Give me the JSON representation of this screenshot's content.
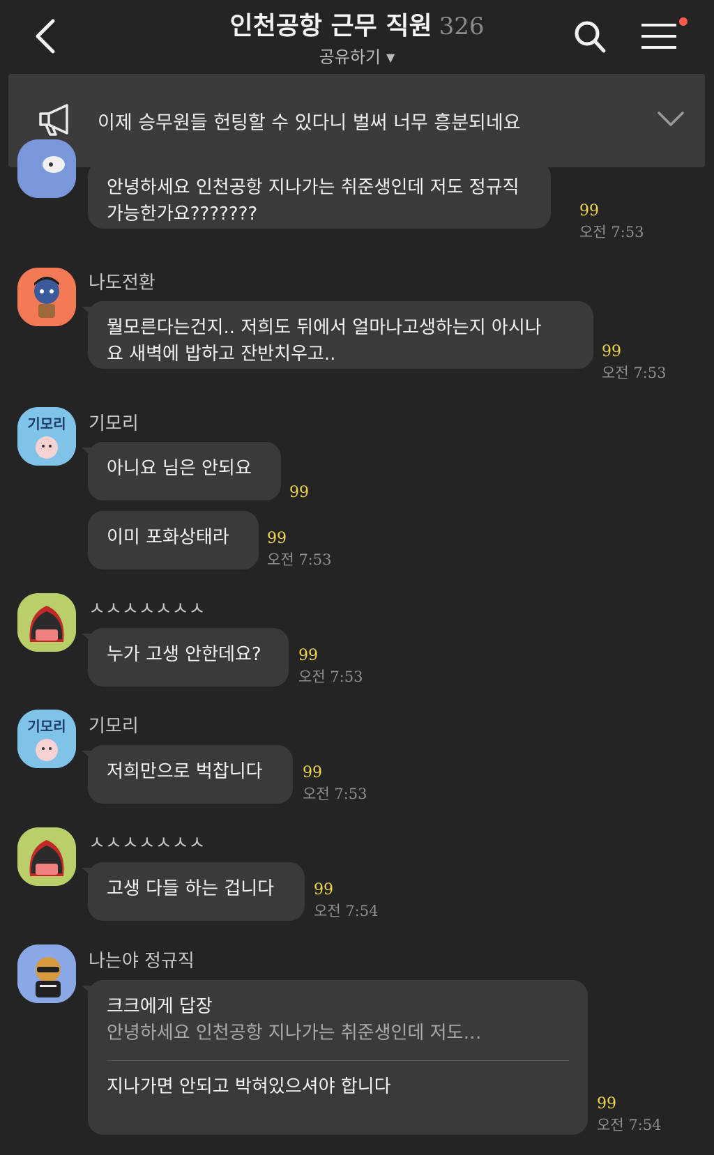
{
  "header": {
    "title": "인천공항 근무 직원",
    "member_count": "326",
    "share_label": "공유하기"
  },
  "notice": {
    "text": "이제 승무원들 헌팅할 수 있다니 벌써 너무 흥분되네요"
  },
  "icons": [
    "back-arrow-icon",
    "search-icon",
    "menu-icon",
    "megaphone-icon",
    "chevron-down-icon"
  ],
  "colors": {
    "background": "#242424",
    "bubble": "#3a3a3c",
    "unread": "#f0d54a",
    "notify_dot": "#ff5a4a"
  },
  "messages": [
    {
      "text": "안녕하세요 인천공항 지나가는 취준생인데 저도 정규직\n가능한가요???????",
      "unread": "99",
      "time": "오전 7:53"
    },
    {
      "sender": "나도전환",
      "text": "뭘모른다는건지.. 저희도 뒤에서 얼마나고생하는지 아시나\n요 새벽에 밥하고 잔반치우고..",
      "unread": "99",
      "time": "오전 7:53"
    },
    {
      "sender": "기모리",
      "avatar_label": "기모리",
      "text": "아니요 님은 안되요",
      "unread": "99"
    },
    {
      "text": "이미 포화상태라",
      "unread": "99",
      "time": "오전 7:53"
    },
    {
      "sender": "ㅅㅅㅅㅅㅅㅅㅅ",
      "text": "누가 고생 안한데요?",
      "unread": "99",
      "time": "오전 7:53"
    },
    {
      "sender": "기모리",
      "avatar_label": "기모리",
      "text": "저희만으로 벅찹니다",
      "unread": "99",
      "time": "오전 7:53"
    },
    {
      "sender": "ㅅㅅㅅㅅㅅㅅㅅ",
      "text": "고생 다들 하는 겁니다",
      "unread": "99",
      "time": "오전 7:54"
    },
    {
      "sender": "나는야 정규직",
      "reply_to": "크크에게 답장",
      "reply_quote": "안녕하세요 인천공항 지나가는 취준생인데 저도…",
      "text": "지나가면 안되고 박혀있으셔야 합니다",
      "unread": "99",
      "time": "오전 7:54"
    }
  ]
}
